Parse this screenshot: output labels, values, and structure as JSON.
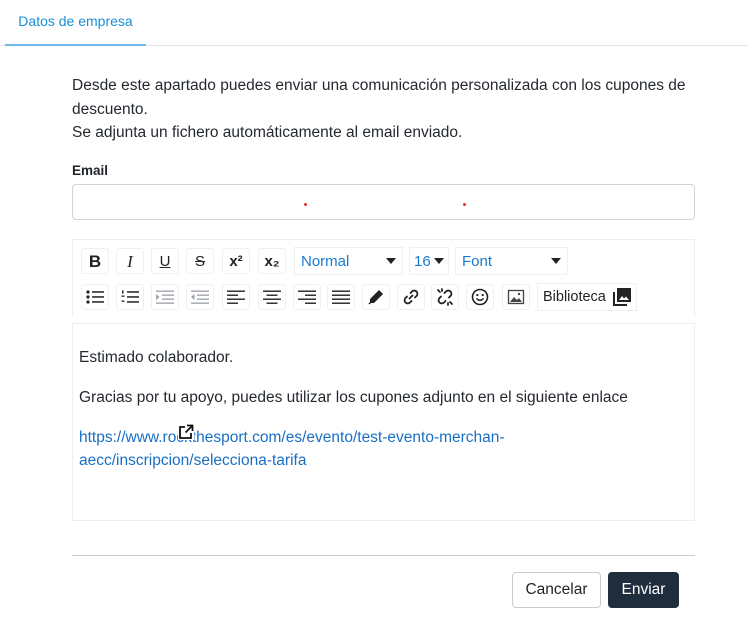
{
  "tabs": [
    {
      "label": "Datos de empresa",
      "active": true
    }
  ],
  "description": {
    "line1": "Desde este apartado puedes enviar una comunicación personalizada con los cupones de descuento.",
    "line2": "Se adjunta un fichero automáticamente al email enviado."
  },
  "email": {
    "label": "Email",
    "value": "",
    "placeholder": ""
  },
  "toolbar": {
    "bold": "B",
    "italic": "I",
    "underline": "U",
    "strike": "S",
    "superscript": "x²",
    "subscript": "x₂",
    "block_format": "Normal",
    "font_size": "16",
    "font_family": "Font",
    "library_label": "Biblioteca"
  },
  "editor": {
    "greeting": "Estimado colaborador.",
    "body": "Gracias por tu apoyo, puedes utilizar los cupones adjunto en el siguiente enlace",
    "link_line1": "https://www.rockthesport.com/es/evento/test-evento-merchan-",
    "link_line2": "aecc/inscripcion/selecciona-tarifa"
  },
  "actions": {
    "cancel": "Cancelar",
    "send": "Enviar"
  },
  "colors": {
    "accent": "#1a8fd6",
    "link": "#1a6fc4",
    "primary_button": "#1f2d3d"
  },
  "icons": {
    "list": [
      "bold-icon",
      "italic-icon",
      "underline-icon",
      "strikethrough-icon",
      "superscript-icon",
      "subscript-icon",
      "bullet-list-icon",
      "numbered-list-icon",
      "indent-icon",
      "outdent-icon",
      "align-left-icon",
      "align-center-icon",
      "align-right-icon",
      "justify-icon",
      "highlight-pen-icon",
      "link-icon",
      "unlink-icon",
      "emoji-icon",
      "image-icon",
      "photo-library-icon",
      "external-link-icon"
    ]
  }
}
